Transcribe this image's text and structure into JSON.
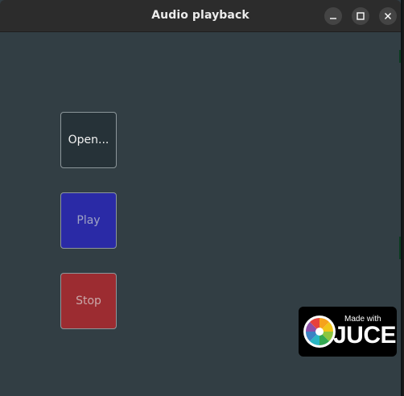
{
  "window": {
    "title": "Audio playback",
    "controls": {
      "minimize_icon": "minimize-icon",
      "maximize_icon": "maximize-icon",
      "close_icon": "close-icon"
    }
  },
  "buttons": {
    "open_label": "Open...",
    "play_label": "Play",
    "stop_label": "Stop"
  },
  "badge": {
    "made_with": "Made with",
    "brand": "JUCE"
  },
  "colors": {
    "background": "#323e44",
    "titlebar": "#2c2c2c",
    "open_button": "#263238",
    "play_button": "#2a2aa6",
    "stop_button": "#9c2c31"
  }
}
